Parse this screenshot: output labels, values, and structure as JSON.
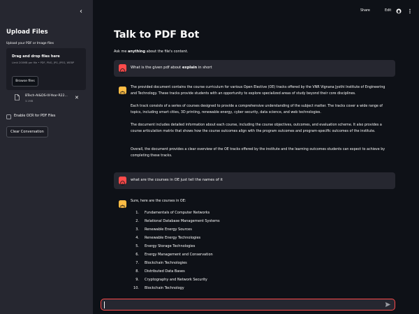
{
  "sidebar": {
    "collapse_icon": "chevron-left-icon",
    "title": "Upload Files",
    "uploader_label": "Upload your PDF or Image files",
    "dropzone_title": "Drag and drop files here",
    "dropzone_hint": "Limit 200MB per file • PDF, PNG, JPG, JPEG, WEBP",
    "browse_label": "Browse files",
    "file_name": "BTech-AI&DS-III-Year-R22...",
    "file_size": "3.1MB",
    "file_icon": "file-icon",
    "close_icon": "close-icon",
    "ocr_label": "Enable OCR for PDF Files",
    "ocr_checked": false,
    "clear_label": "Clear Conversation"
  },
  "topbar": {
    "share": "Share",
    "edit": "Edit",
    "github_icon": "github-icon",
    "menu_icon": "more-vertical-icon"
  },
  "main": {
    "title": "Talk to PDF Bot",
    "caption_prefix": "Ask me ",
    "caption_bold": "anything",
    "caption_suffix": " about the file's content."
  },
  "chat": {
    "q1": {
      "prefix": "What is the given pdf about ",
      "bold": "explain",
      "suffix": " in short"
    },
    "a1": [
      "The provided document contains the course curriculum for various Open Elective (OE) tracks offered by the VNR Vignana Jyothi Institute of Engineering and Technology. These tracks provide students with an opportunity to explore specialized areas of study beyond their core disciplines.",
      "Each track consists of a series of courses designed to provide a comprehensive understanding of the subject matter. The tracks cover a wide range of topics, including smart cities, 3D printing, renewable energy, cyber security, data science, and web technologies.",
      "The document includes detailed information about each course, including the course objectives, outcomes, and evaluation scheme. It also provides a course articulation matrix that shows how the course outcomes align with the program outcomes and program-specific outcomes of the institute.",
      "Overall, the document provides a clear overview of the OE tracks offered by the institute and the learning outcomes students can expect to achieve by completing these tracks."
    ],
    "q2": "what are the courses in OE just tell the names of it",
    "a2_intro": "Sure, here are the courses in OE:",
    "a2_courses": [
      "Fundamentals of Computer Networks",
      "Relational Database Management Systems",
      "Renewable Energy Sources",
      "Renewable Energy Technologies",
      "Energy Storage Technologies",
      "Energy Management and Conservation",
      "Blockchain Technologies",
      "Distributed Data Bases",
      "Cryptography and Network Security",
      "Blockchain Technology"
    ]
  },
  "input": {
    "placeholder": "",
    "send_icon": "send-icon"
  },
  "colors": {
    "background": "#0e1117",
    "sidebar": "#262730",
    "accent": "#ff4b4b",
    "bot_avatar": "#ffbd45"
  }
}
